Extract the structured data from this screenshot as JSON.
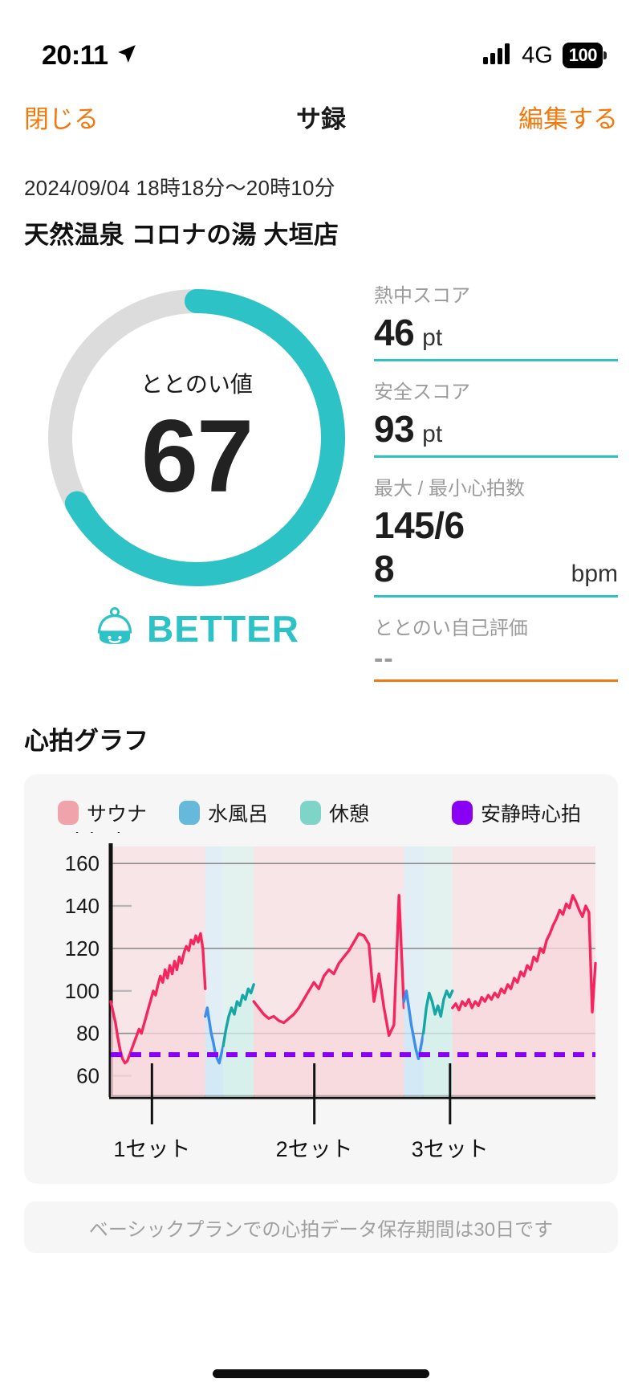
{
  "status_bar": {
    "time": "20:11",
    "location_icon": "location-arrow-icon",
    "signal_icon": "cellular-bars-icon",
    "network": "4G",
    "battery_level": "100"
  },
  "nav": {
    "close_label": "閉じる",
    "title": "サ録",
    "edit_label": "編集する"
  },
  "header": {
    "date_range": "2024/09/04 18時18分〜20時10分",
    "venue": "天然温泉 コロナの湯 大垣店"
  },
  "score": {
    "donut_label": "ととのい値",
    "donut_value": "67",
    "donut_percent": 67,
    "rank_label": "BETTER",
    "rank_icon": "sauna-hat-icon",
    "accent_color": "#2DC2C6",
    "track_color": "#DCDCDC"
  },
  "stats": [
    {
      "label": "熱中スコア",
      "value": "46",
      "unit": "pt",
      "underline": "#2DC2C6"
    },
    {
      "label": "安全スコア",
      "value": "93",
      "unit": "pt",
      "underline": "#2DC2C6"
    },
    {
      "label": "最大 / 最小心拍数",
      "value_line1": "145/6",
      "value_line2": "8",
      "unit": "bpm",
      "underline": "#2DC2C6"
    },
    {
      "label": "ととのい自己評価",
      "value": "--",
      "unit": "",
      "underline": "#F2790D"
    }
  ],
  "chart_section": {
    "title": "心拍グラフ",
    "footer_note": "ベーシックプランでの心拍データ保存期間は30日です"
  },
  "chart_data": {
    "type": "line",
    "title": "心拍グラフ",
    "ylabel": "(bpm)",
    "xlabel": "",
    "ylim": [
      50,
      168
    ],
    "yticks": [
      60,
      80,
      100,
      120,
      140,
      160
    ],
    "ytick_labels": [
      "60",
      "80",
      "100",
      "120",
      "140",
      "160"
    ],
    "major_gridlines": [
      80,
      120,
      160
    ],
    "grid": true,
    "legend_position": "top",
    "legend": [
      {
        "name": "サウナ",
        "color": "#F0A3AB"
      },
      {
        "name": "水風呂",
        "color": "#67B9DB"
      },
      {
        "name": "休憩",
        "color": "#7FD4C8"
      },
      {
        "name": "安静時心拍",
        "color": "#8A00F5"
      }
    ],
    "x_tick_labels": [
      "1セット",
      "2セット",
      "3セット"
    ],
    "x_tick_positions": [
      0.085,
      0.42,
      0.7
    ],
    "resting_hr": 70,
    "resting_hr_style": "dashed",
    "resting_hr_color": "#8A00F5",
    "series": [
      {
        "name": "心拍数 (サウナ)",
        "color": "#F5265E",
        "fill": "#F7D7DC",
        "values": [
          95,
          90,
          85,
          78,
          72,
          68,
          66,
          67,
          70,
          73,
          76,
          79,
          82,
          80,
          84,
          88,
          92,
          96,
          100,
          98,
          103,
          107,
          104,
          110,
          106,
          112,
          108,
          114,
          110,
          116,
          113,
          118,
          121,
          119,
          124,
          122,
          126,
          123,
          127,
          120,
          101
        ]
      },
      {
        "name": "心拍数 (水風呂 1)",
        "color": "#3D8EE8",
        "fill": "#CFE7F5",
        "values": [
          88,
          92,
          86,
          80,
          76,
          71,
          68,
          66,
          70,
          74
        ]
      },
      {
        "name": "心拍数 (休憩 1)",
        "color": "#17A6A6",
        "fill": "#D4EFEA",
        "values": [
          74,
          82,
          88,
          92,
          89,
          95,
          93,
          98,
          96,
          101,
          99,
          103
        ]
      },
      {
        "name": "心拍数 (サウナ 2)",
        "color": "#F5265E",
        "fill": "#F7D7DC",
        "values": [
          95,
          92,
          89,
          87,
          88,
          86,
          85,
          87,
          89,
          92,
          96,
          100,
          104,
          101,
          107,
          110,
          108,
          113,
          116,
          119,
          123,
          127,
          126,
          122,
          95,
          108,
          92,
          79,
          84,
          145,
          92
        ]
      },
      {
        "name": "心拍数 (水風呂 2)",
        "color": "#3D8EE8",
        "fill": "#CFE7F5",
        "values": [
          95,
          100,
          92,
          84,
          78,
          72,
          68,
          74,
          80
        ]
      },
      {
        "name": "心拍数 (休憩 2)",
        "color": "#17A6A6",
        "fill": "#D4EFEA",
        "values": [
          80,
          92,
          99,
          95,
          89,
          93,
          88,
          96,
          100,
          97,
          100
        ]
      },
      {
        "name": "心拍数 (サウナ 3)",
        "color": "#F5265E",
        "fill": "#F7D7DC",
        "values": [
          92,
          94,
          91,
          95,
          93,
          96,
          92,
          95,
          93,
          97,
          95,
          98,
          96,
          99,
          97,
          101,
          99,
          103,
          101,
          106,
          104,
          109,
          107,
          112,
          110,
          116,
          114,
          120,
          118,
          124,
          127,
          131,
          134,
          138,
          136,
          141,
          139,
          145,
          142,
          138,
          135,
          140,
          137,
          90,
          113
        ]
      }
    ],
    "zones": [
      {
        "type": "サウナ",
        "start": 0.0,
        "end": 0.195,
        "color": "#F7D7DC"
      },
      {
        "type": "水風呂",
        "start": 0.195,
        "end": 0.232,
        "color": "#CFE7F5"
      },
      {
        "type": "休憩",
        "start": 0.232,
        "end": 0.295,
        "color": "#D4EFEA"
      },
      {
        "type": "サウナ",
        "start": 0.295,
        "end": 0.605,
        "color": "#F7D7DC"
      },
      {
        "type": "水風呂",
        "start": 0.605,
        "end": 0.645,
        "color": "#CFE7F5"
      },
      {
        "type": "休憩",
        "start": 0.645,
        "end": 0.705,
        "color": "#D4EFEA"
      },
      {
        "type": "サウナ",
        "start": 0.705,
        "end": 1.0,
        "color": "#F7D7DC"
      }
    ]
  }
}
